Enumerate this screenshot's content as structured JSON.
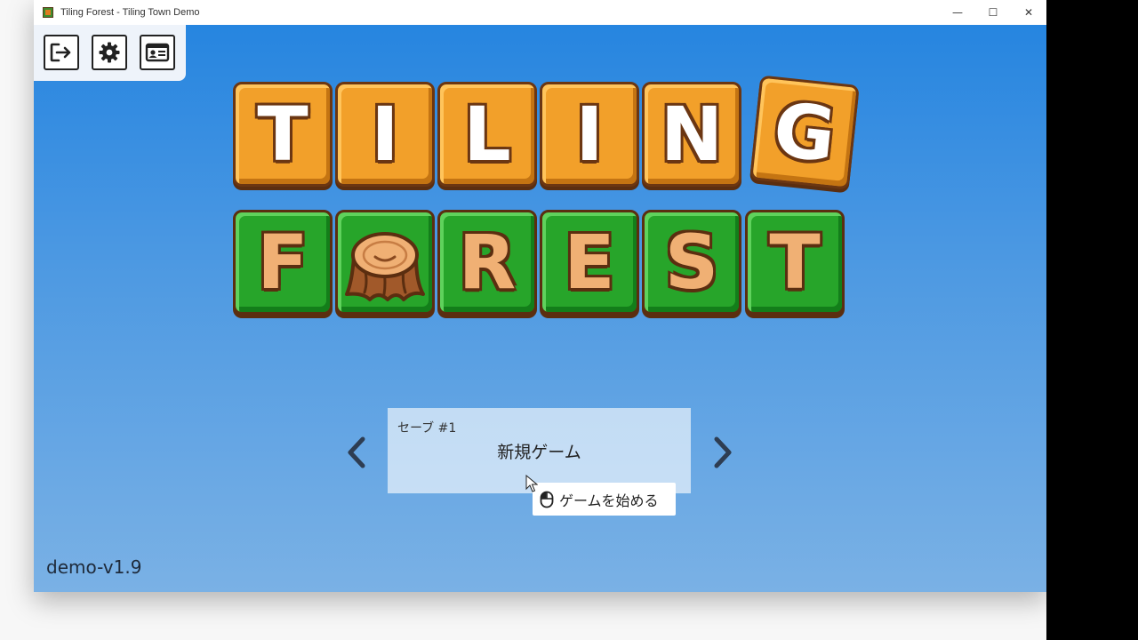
{
  "window": {
    "title": "Tiling Forest - Tiling Town Demo",
    "controls": {
      "minimize": "—",
      "maximize": "☐",
      "close": "✕"
    }
  },
  "toolbar": {
    "buttons": [
      {
        "name": "exit",
        "icon": "exit-icon"
      },
      {
        "name": "settings",
        "icon": "gear-icon"
      },
      {
        "name": "profile",
        "icon": "id-card-icon"
      }
    ]
  },
  "logo": {
    "row1": [
      "T",
      "I",
      "L",
      "I",
      "N",
      "G"
    ],
    "row2": [
      "F",
      "O",
      "R",
      "E",
      "S",
      "T"
    ],
    "row2_special_icon": "tree-stump-icon",
    "colors": {
      "orange": "#f2a02a",
      "green": "#27a52a",
      "outline": "#5b2e10"
    }
  },
  "save": {
    "slot_label": "セーブ #1",
    "title": "新規ゲーム",
    "prev_icon": "chevron-left-icon",
    "next_icon": "chevron-right-icon"
  },
  "tooltip": {
    "icon": "mouse-left-click-icon",
    "text": "ゲームを始める"
  },
  "version": "demo-v1.9"
}
